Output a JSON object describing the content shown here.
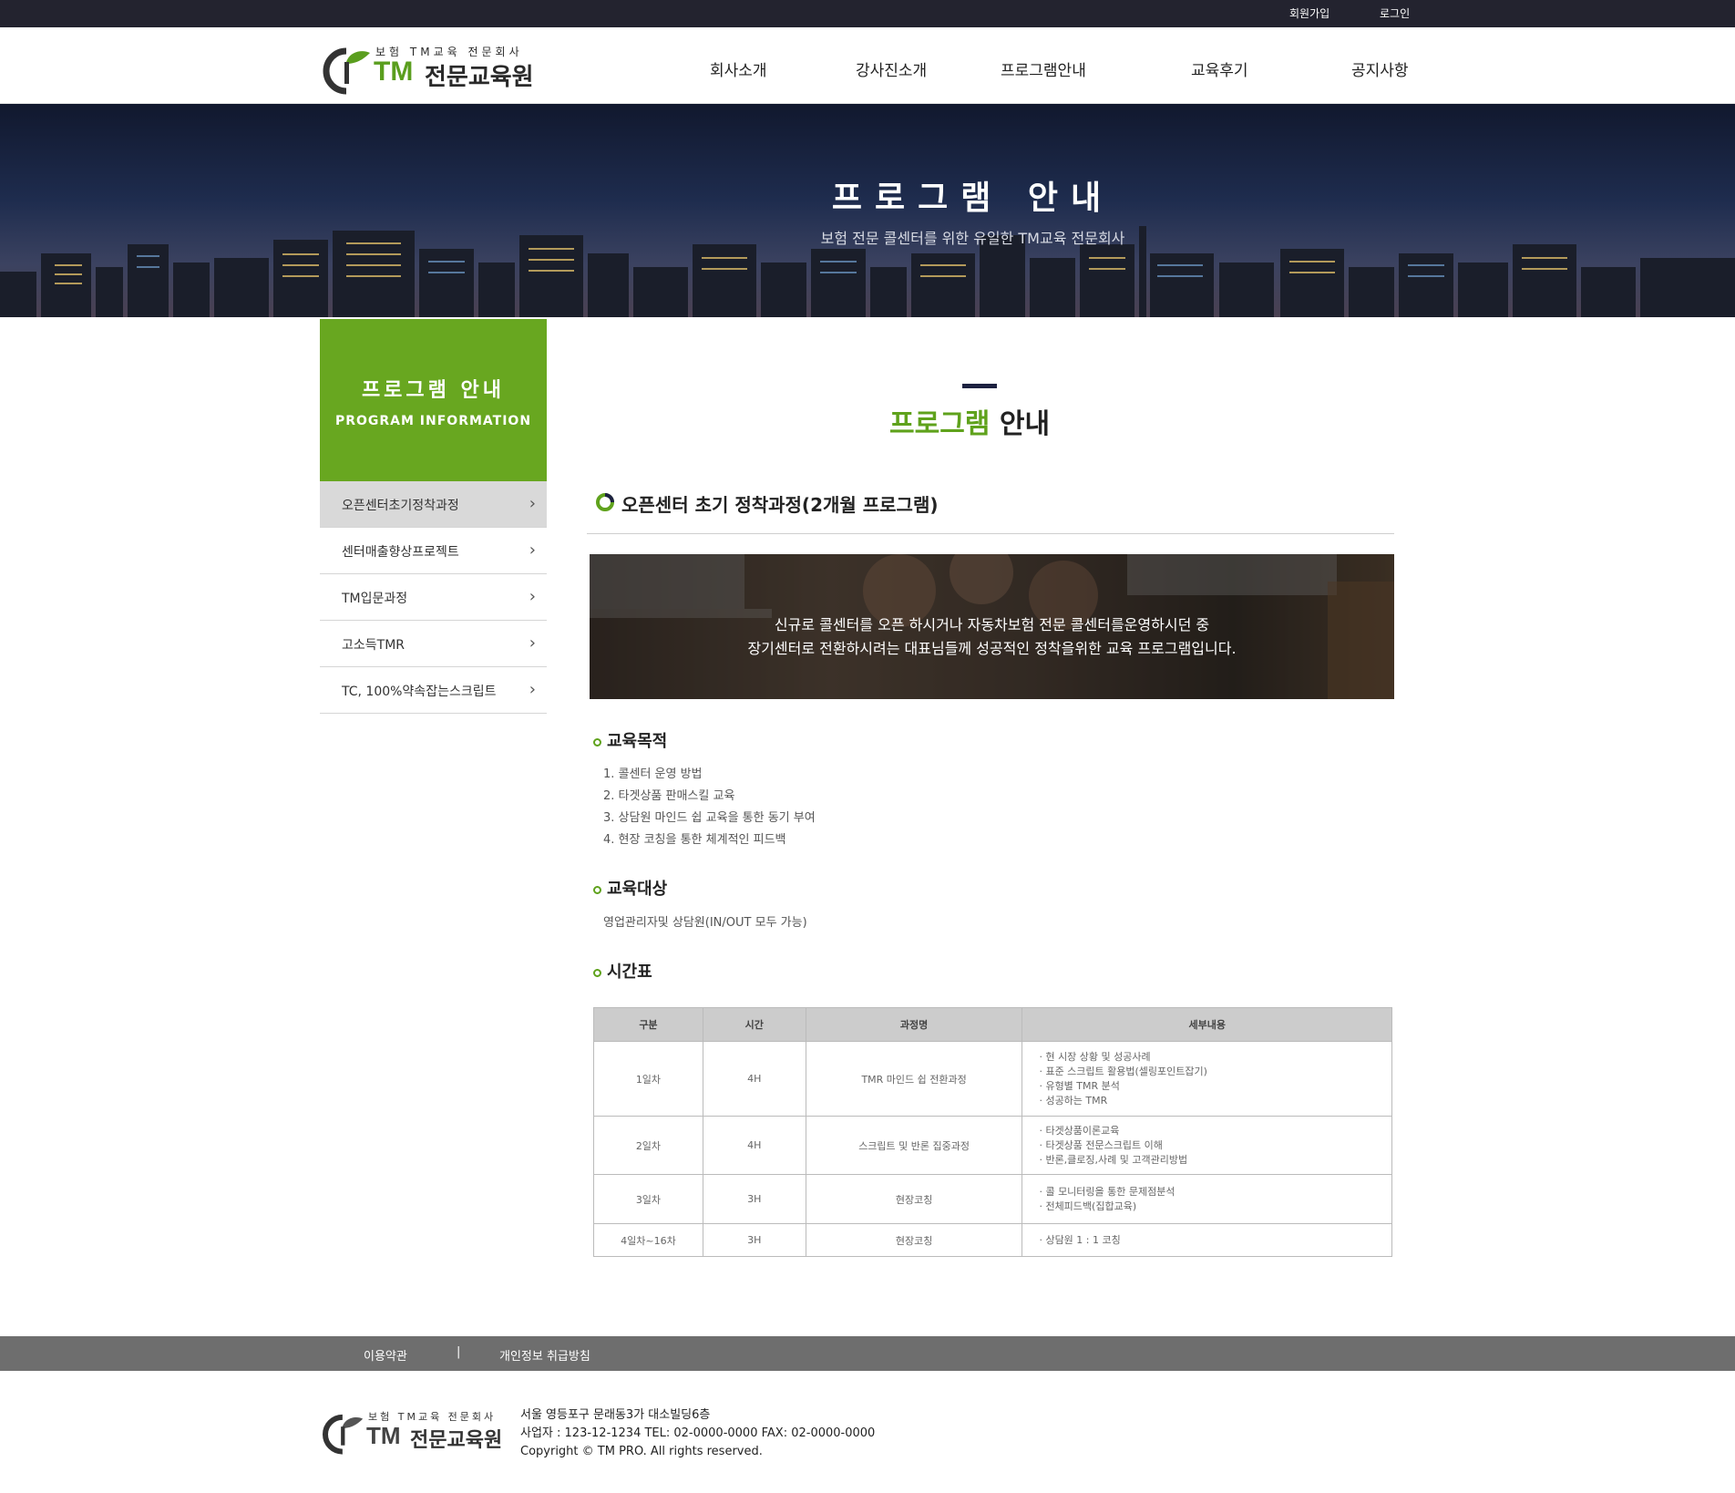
{
  "topbar": {
    "join": "회원가입",
    "login": "로그인"
  },
  "logo": {
    "sub": "보험 TM교육 전문회사",
    "tm": "TM",
    "name": "전문교육원"
  },
  "nav": [
    "회사소개",
    "강사진소개",
    "프로그램안내",
    "교육후기",
    "공지사항"
  ],
  "banner": {
    "title": "프로그램 안내",
    "subtitle": "보험 전문 콜센터를 위한 유일한 TM교육 전문회사"
  },
  "side": {
    "title": "프로그램 안내",
    "subtitle": "PROGRAM INFORMATION",
    "items": [
      {
        "label": "오픈센터초기정착과정",
        "active": true
      },
      {
        "label": "센터매출향상프로젝트",
        "active": false
      },
      {
        "label": "TM입문과정",
        "active": false
      },
      {
        "label": "고소득TMR",
        "active": false
      },
      {
        "label": "TC, 100%약속잡는스크립트",
        "active": false
      }
    ]
  },
  "content": {
    "title_green": "프로그램",
    "title_dark": "안내",
    "section_title": "오픈센터 초기 정착과정(2개월 프로그램)",
    "intro_line1": "신규로 콜센터를 오픈 하시거나 자동차보험 전문 콜센터를운영하시던 중",
    "intro_line2": "장기센터로 전환하시려는 대표님들께 성공적인 정착을위한 교육 프로그램입니다.",
    "goal_heading": "교육목적",
    "goals": [
      "1. 콜센터 운영 방법",
      "2. 타겟상품 판매스킬 교육",
      "3. 상담원 마인드 쉽 교육을 통한 동기 부여",
      "4. 현장 코칭을 통한 체계적인 피드백"
    ],
    "target_heading": "교육대상",
    "target_text": "영업관리자및 상담원(IN/OUT 모두 가능)",
    "schedule_heading": "시간표",
    "table_headers": [
      "구분",
      "시간",
      "과정명",
      "세부내용"
    ],
    "rows": [
      {
        "day": "1일차",
        "time": "4H",
        "course": "TMR 마인드 쉽 전환과정",
        "details": [
          "· 현 시장 상황 및 성공사례",
          "· 표준 스크립트 활용법(셀링포인트잡기)",
          "· 유형별 TMR 분석",
          "· 성공하는 TMR"
        ]
      },
      {
        "day": "2일차",
        "time": "4H",
        "course": "스크립트 및 반론 집중과정",
        "details": [
          "· 타겟상품이론교육",
          "· 타겟상품 전문스크립트 이해",
          "· 반론,클로징,사례 및 고객관리방법"
        ]
      },
      {
        "day": "3일차",
        "time": "3H",
        "course": "현장코칭",
        "details": [
          "· 콜 모니터링을 통한 문제점분석",
          "· 전체피드백(집합교육)"
        ]
      },
      {
        "day": "4일차~16차",
        "time": "3H",
        "course": "현장코칭",
        "details": [
          "· 상담원 1 : 1 코칭"
        ]
      }
    ]
  },
  "footer": {
    "terms": "이용약관",
    "separator": "|",
    "privacy": "개인정보 취급방침",
    "address": "서울 영등포구 문래동3가 대소빌딩6층",
    "business": "사업자 : 123-12-1234 TEL: 02-0000-0000 FAX: 02-0000-0000",
    "copyright": "Copyright © TM PRO. All rights reserved."
  },
  "colors": {
    "accent_green": "#68a720",
    "topbar": "#23232f",
    "footer_bar": "#6e6e6e"
  }
}
